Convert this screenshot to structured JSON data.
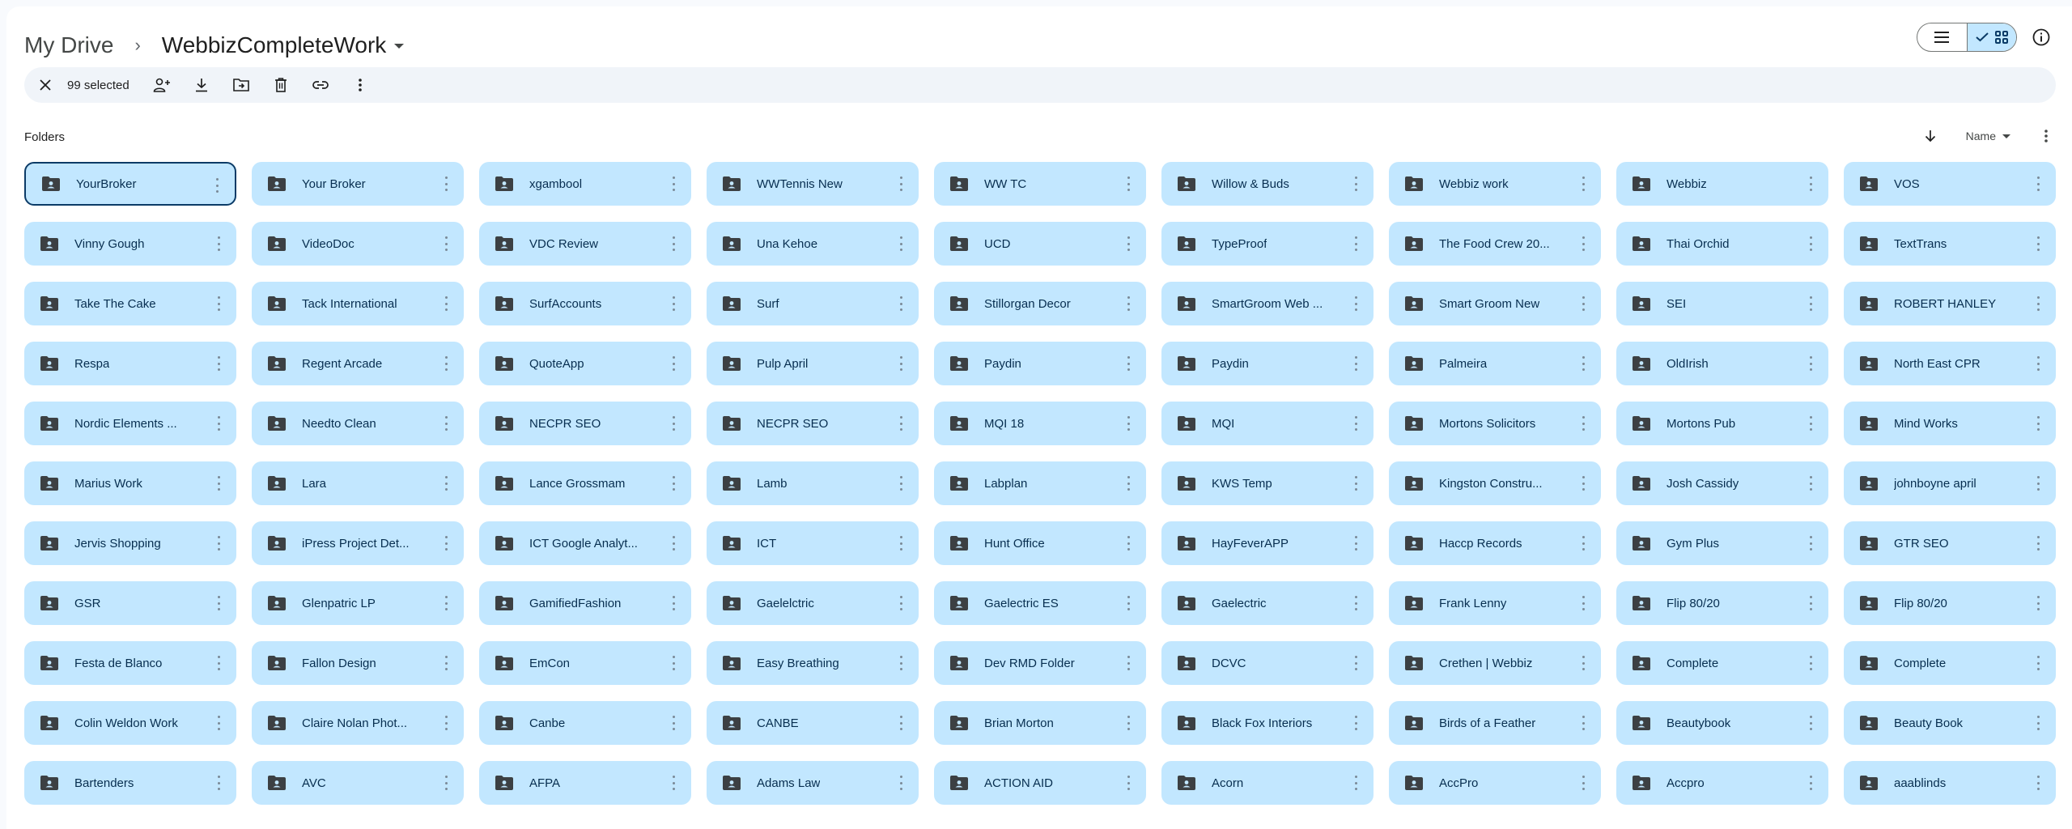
{
  "breadcrumb": {
    "root": "My Drive",
    "separator": "›",
    "current": "WebbizCompleteWork"
  },
  "view_toggle": {
    "list_icon": "list-icon",
    "grid_icon": "grid-icon",
    "active": "grid"
  },
  "info_icon": "info-icon",
  "action_bar": {
    "close_icon": "close-icon",
    "selected_text": "99 selected",
    "actions": [
      {
        "name": "share-icon"
      },
      {
        "name": "download-icon"
      },
      {
        "name": "move-to-folder-icon"
      },
      {
        "name": "trash-icon"
      },
      {
        "name": "copy-link-icon"
      },
      {
        "name": "more-vert-icon"
      }
    ]
  },
  "section": {
    "title": "Folders",
    "sort_direction_icon": "arrow-down-icon",
    "sort_label": "Name",
    "more_icon": "more-vert-icon"
  },
  "colors": {
    "folder_bg": "#c2e7ff",
    "folder_text": "#072e4f",
    "focus_border": "#0b3b67",
    "action_bar_bg": "#f0f4f9"
  },
  "folders": [
    "YourBroker",
    "Your Broker",
    "xgambool",
    "WWTennis New",
    "WW TC",
    "Willow & Buds",
    "Webbiz work",
    "Webbiz",
    "VOS",
    "Vinny Gough",
    "VideoDoc",
    "VDC Review",
    "Una Kehoe",
    "UCD",
    "TypeProof",
    "The Food Crew 20...",
    "Thai Orchid",
    "TextTrans",
    "Take The Cake",
    "Tack International",
    "SurfAccounts",
    "Surf",
    "Stillorgan Decor",
    "SmartGroom Web ...",
    "Smart Groom New",
    "SEI",
    "ROBERT HANLEY",
    "Respa",
    "Regent Arcade",
    "QuoteApp",
    "Pulp April",
    "Paydin",
    "Paydin",
    "Palmeira",
    "OldIrish",
    "North East CPR",
    "Nordic Elements ...",
    "Needto Clean",
    "NECPR SEO",
    "NECPR SEO",
    "MQI 18",
    "MQI",
    "Mortons Solicitors",
    "Mortons Pub",
    "Mind Works",
    "Marius Work",
    "Lara",
    "Lance Grossmam",
    "Lamb",
    "Labplan",
    "KWS Temp",
    "Kingston Constru...",
    "Josh Cassidy",
    "johnboyne april",
    "Jervis Shopping",
    "iPress Project Det...",
    "ICT Google Analyt...",
    "ICT",
    "Hunt Office",
    "HayFeverAPP",
    "Haccp Records",
    "Gym Plus",
    "GTR SEO",
    "GSR",
    "Glenpatric LP",
    "GamifiedFashion",
    "Gaelelctric",
    "Gaelectric ES",
    "Gaelectric",
    "Frank Lenny",
    "Flip 80/20",
    "Flip 80/20",
    "Festa de Blanco",
    "Fallon Design",
    "EmCon",
    "Easy Breathing",
    "Dev RMD Folder",
    "DCVC",
    "Crethen | Webbiz",
    "Complete",
    "Complete",
    "Colin Weldon Work",
    "Claire Nolan Phot...",
    "Canbe",
    "CANBE",
    "Brian Morton",
    "Black Fox Interiors",
    "Birds of a Feather",
    "Beautybook",
    "Beauty Book",
    "Bartenders",
    "AVC",
    "AFPA",
    "Adams Law",
    "ACTION AID",
    "Acorn",
    "AccPro",
    "Accpro",
    "aaablinds"
  ]
}
